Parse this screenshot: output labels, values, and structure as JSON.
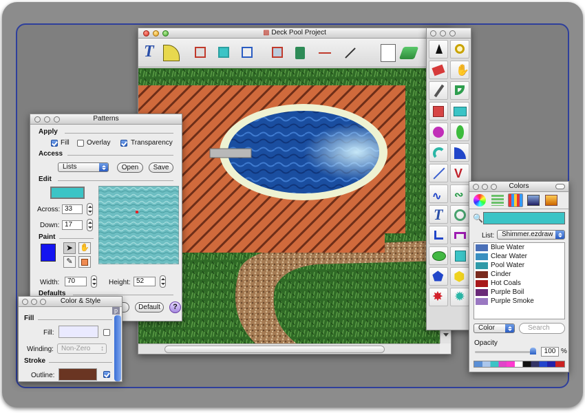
{
  "main_window": {
    "title": "Deck Pool Project"
  },
  "patterns": {
    "title": "Patterns",
    "apply_label": "Apply",
    "fill_label": "Fill",
    "overlay_label": "Overlay",
    "transparency_label": "Transparency",
    "fill_checked": true,
    "overlay_checked": false,
    "transparency_checked": true,
    "access_label": "Access",
    "lists_value": "Lists",
    "open_label": "Open",
    "save_label": "Save",
    "edit_label": "Edit",
    "across_label": "Across:",
    "across_value": "33",
    "down_label": "Down:",
    "down_value": "17",
    "paint_label": "Paint",
    "width_label": "Width:",
    "width_value": "70",
    "height_label": "Height:",
    "height_value": "52",
    "defaults_label": "Defaults",
    "default_label": "Default",
    "help_label": "?"
  },
  "color_style": {
    "title": "Color & Style",
    "fill_section": "Fill",
    "fill_label": "Fill:",
    "winding_label": "Winding:",
    "winding_value": "Non-Zero",
    "stroke_section": "Stroke",
    "outline_label": "Outline:",
    "outline_checked": true,
    "tab_label": "p"
  },
  "colors": {
    "title": "Colors",
    "list_label": "List:",
    "list_value": "Shimmer.ezdraw",
    "items": [
      "Blue Water",
      "Clear Water",
      "Pool Water",
      "Cinder",
      "Hot Coals",
      "Purple Boil",
      "Purple Smoke"
    ],
    "color_popup": "Color",
    "search_placeholder": "Search",
    "opacity_label": "Opacity",
    "opacity_value": "100",
    "opacity_unit": "%"
  },
  "colors_hex": {
    "accent": "#3bc4c6",
    "outline": "#6a3522",
    "paint": "#1414f0",
    "deck": "#d06a3c"
  }
}
